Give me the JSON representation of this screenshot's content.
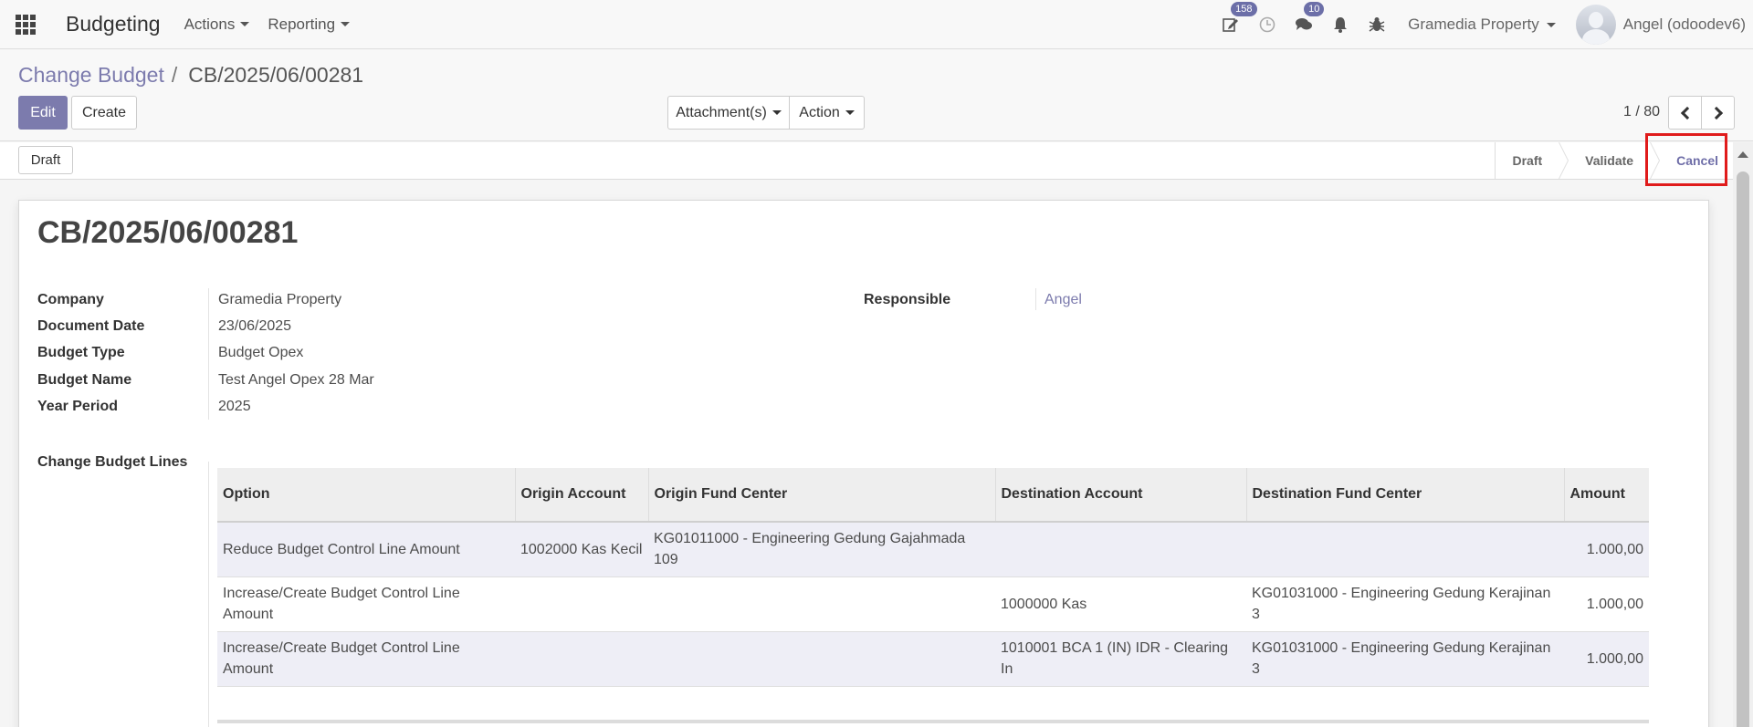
{
  "navbar": {
    "app_name": "Budgeting",
    "menus": [
      {
        "label": "Actions"
      },
      {
        "label": "Reporting"
      }
    ],
    "activity_badge": "158",
    "messages_badge": "10",
    "company": "Gramedia Property",
    "user": "Angel (odoodev6)"
  },
  "breadcrumb": {
    "parent": "Change Budget",
    "separator": "/",
    "current": "CB/2025/06/00281"
  },
  "buttons": {
    "edit": "Edit",
    "create": "Create",
    "attachments": "Attachment(s)",
    "action": "Action"
  },
  "pager": {
    "value": "1 / 80"
  },
  "statusbar": {
    "draft_button": "Draft",
    "steps": [
      "Draft",
      "Validate",
      "Cancel"
    ],
    "active_step": "Cancel",
    "highlight_color": "#e01b1b"
  },
  "form": {
    "title": "CB/2025/06/00281",
    "fields": {
      "company": {
        "label": "Company",
        "value": "Gramedia Property"
      },
      "document_date": {
        "label": "Document Date",
        "value": "23/06/2025"
      },
      "budget_type": {
        "label": "Budget Type",
        "value": "Budget Opex"
      },
      "budget_name": {
        "label": "Budget Name",
        "value": "Test Angel Opex 28 Mar"
      },
      "year_period": {
        "label": "Year Period",
        "value": "2025"
      },
      "responsible": {
        "label": "Responsible",
        "value": "Angel"
      }
    },
    "lines_label": "Change Budget Lines"
  },
  "lines_table": {
    "headers": [
      "Option",
      "Origin Account",
      "Origin Fund Center",
      "Destination Account",
      "Destination Fund Center",
      "Amount"
    ],
    "rows": [
      [
        "Reduce Budget Control Line Amount",
        "1002000 Kas Kecil",
        "KG01011000 - Engineering Gedung Gajahmada 109",
        "",
        "",
        "1.000,00"
      ],
      [
        "Increase/Create Budget Control Line Amount",
        "",
        "",
        "1000000 Kas",
        "KG01031000 - Engineering Gedung Kerajinan 3",
        "1.000,00"
      ],
      [
        "Increase/Create Budget Control Line Amount",
        "",
        "",
        "1010001 BCA 1 (IN) IDR - Clearing In",
        "KG01031000 - Engineering Gedung Kerajinan 3",
        "1.000,00"
      ]
    ]
  },
  "colors": {
    "brand": "#7c7bad",
    "odd_row": "#eeeef6"
  }
}
